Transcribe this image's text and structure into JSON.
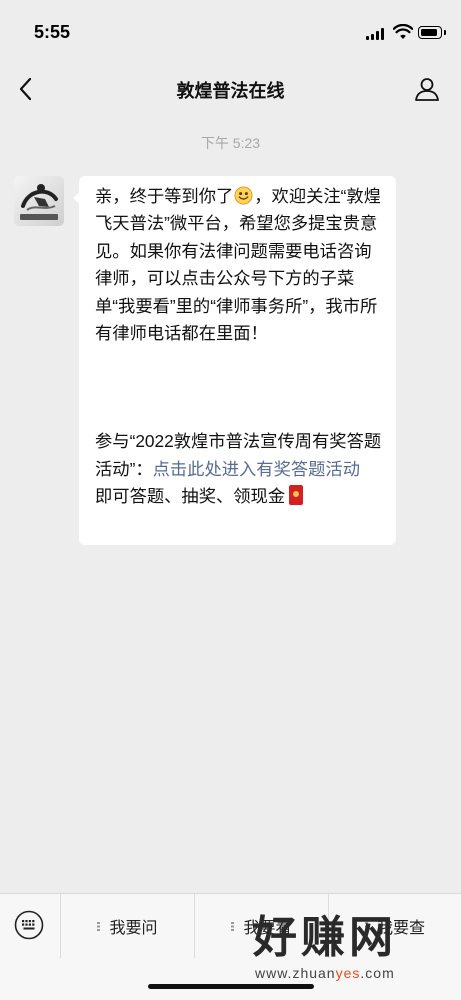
{
  "status_bar": {
    "time": "5:55"
  },
  "nav": {
    "title": "敦煌普法在线"
  },
  "chat": {
    "timestamp": "下午 5:23",
    "message": {
      "p1_before_emoji": "亲，终于等到你了",
      "p1_after_emoji": "，欢迎关注“敦煌飞天普法”微平台，希望您多提宝贵意见。如果你有法律问题需要电话咨询律师，可以点击公众号下方的子菜单“我要看”里的“律师事务所”，我市所有律师电话都在里面！",
      "p2_before_link": "参与“2022敦煌市普法宣传周有奖答题活动”：",
      "p2_link": "点击此处进入有奖答题活动",
      "p2_after_link": " 即可答题、抽奖、领现金"
    }
  },
  "menu": {
    "items": [
      "我要问",
      "我要看",
      "我要查"
    ]
  },
  "watermark": {
    "main": "好赚网",
    "url_prefix": "www.zhuan",
    "url_accent": "yes",
    "url_suffix": ".com"
  },
  "colors": {
    "background": "#ededed",
    "bubble": "#ffffff",
    "link": "#576b95",
    "timestamp": "#a8a8a8",
    "menu_bar": "#f7f7f7"
  },
  "icons": [
    "back-chevron-icon",
    "profile-icon",
    "keyboard-icon",
    "smile-emoji-icon",
    "red-envelope-emoji-icon",
    "signal-icon",
    "wifi-icon",
    "battery-icon"
  ]
}
